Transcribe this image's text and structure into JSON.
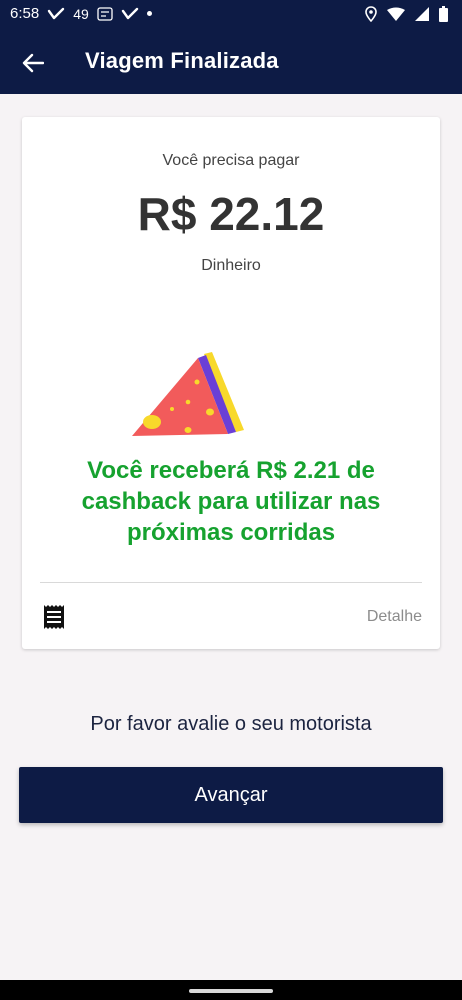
{
  "status_bar": {
    "time": "6:58",
    "notification_count": "49"
  },
  "header": {
    "title": "Viagem Finalizada"
  },
  "payment": {
    "label": "Você precisa pagar",
    "amount": "R$ 22.12",
    "method": "Dinheiro"
  },
  "cashback": {
    "message": "Você receberá R$ 2.21 de cashback para utilizar nas próximas corridas"
  },
  "details": {
    "link_label": "Detalhe"
  },
  "rating": {
    "prompt": "Por favor avalie o seu motorista"
  },
  "actions": {
    "next_label": "Avançar"
  },
  "icons": [
    "back-arrow-icon",
    "receipt-icon",
    "pizza-illustration",
    "location-icon",
    "wifi-icon",
    "signal-icon",
    "battery-icon"
  ],
  "colors": {
    "primary": "#0d1b45",
    "cashback_green": "#16a22f",
    "background": "#f6f3f5"
  }
}
